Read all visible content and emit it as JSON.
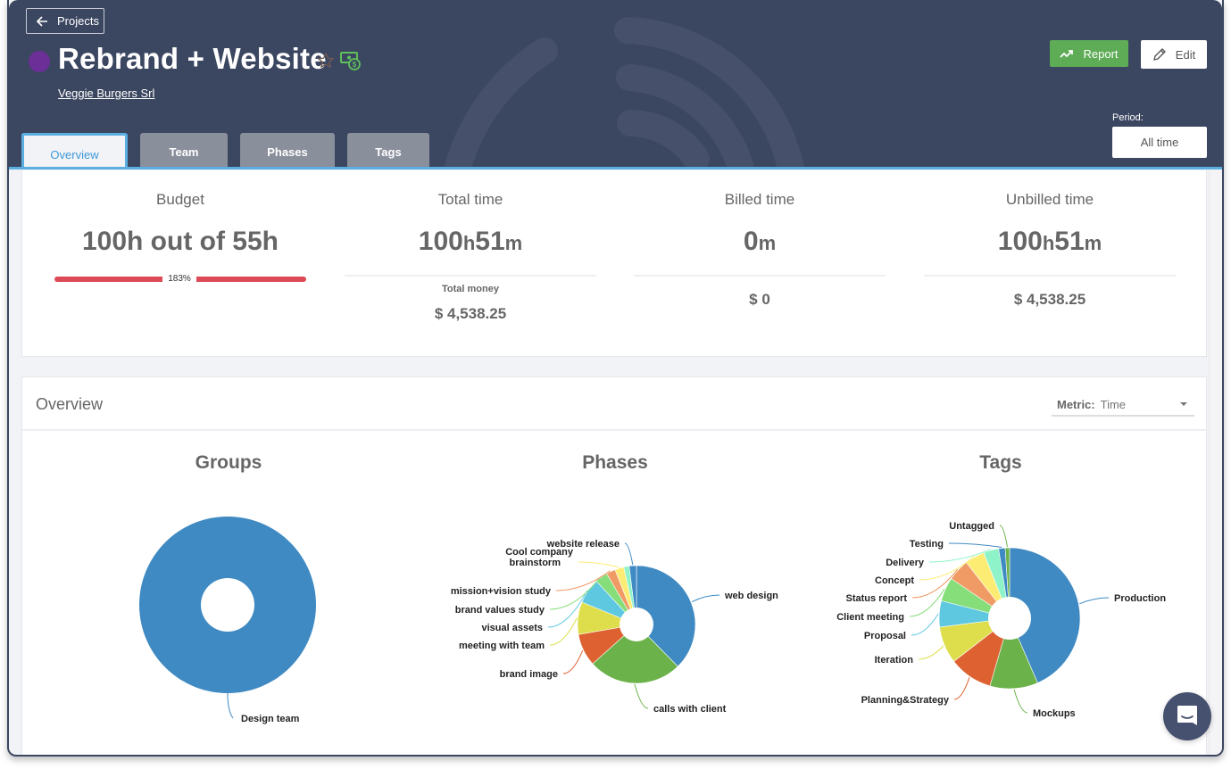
{
  "header": {
    "back_label": "Projects",
    "project_title": "Rebrand + Website",
    "project_color": "#6c2f98",
    "client_name": "Veggie Burgers Srl",
    "report_label": "Report",
    "edit_label": "Edit",
    "period_label": "Period:",
    "period_value": "All time"
  },
  "tabs": [
    {
      "label": "Overview",
      "active": true
    },
    {
      "label": "Team",
      "active": false
    },
    {
      "label": "Phases",
      "active": false
    },
    {
      "label": "Tags",
      "active": false
    }
  ],
  "stats": {
    "budget": {
      "label": "Budget",
      "value": "100h out of 55h",
      "percent_label": "183%",
      "percent": 183,
      "bar_color": "#dc4b55"
    },
    "total_time": {
      "label": "Total time",
      "hours": "100",
      "h": "h",
      "minutes": "51",
      "m": "m",
      "money_label": "Total money",
      "money": "$ 4,538.25"
    },
    "billed_time": {
      "label": "Billed time",
      "minutes": "0",
      "m": "m",
      "money": "$ 0"
    },
    "unbilled_time": {
      "label": "Unbilled time",
      "hours": "100",
      "h": "h",
      "minutes": "51",
      "m": "m",
      "money": "$ 4,538.25"
    }
  },
  "overview": {
    "title": "Overview",
    "metric_label": "Metric:",
    "metric_value": "Time"
  },
  "chart_data": [
    {
      "type": "pie",
      "title": "Groups",
      "slices": [
        {
          "label": "Design team",
          "value": 100,
          "color": "#3f8ac2"
        }
      ]
    },
    {
      "type": "pie",
      "title": "Phases",
      "slices": [
        {
          "label": "web design",
          "value": 38,
          "color": "#3f8ac2"
        },
        {
          "label": "calls with client",
          "value": 26,
          "color": "#6cb24a"
        },
        {
          "label": "brand image",
          "value": 9,
          "color": "#de6231"
        },
        {
          "label": "meeting with team",
          "value": 9,
          "color": "#dede4c"
        },
        {
          "label": "visual assets",
          "value": 7,
          "color": "#5ec8e0"
        },
        {
          "label": "brand values study",
          "value": 3.5,
          "color": "#86de7a"
        },
        {
          "label": "mission+vision study",
          "value": 2.5,
          "color": "#f09a65"
        },
        {
          "label": "Cool company brainstorm",
          "value": 2.5,
          "color": "#fdec74"
        },
        {
          "label": "",
          "value": 1.5,
          "color": "#8ef3c8"
        },
        {
          "label": "website release",
          "value": 2,
          "color": "#3f8ac2"
        }
      ]
    },
    {
      "type": "pie",
      "title": "Tags",
      "slices": [
        {
          "label": "Production",
          "value": 43.5,
          "color": "#3f8ac2"
        },
        {
          "label": "Mockups",
          "value": 11,
          "color": "#6cb24a"
        },
        {
          "label": "Planning&Strategy",
          "value": 10,
          "color": "#de6231"
        },
        {
          "label": "Iteration",
          "value": 8.5,
          "color": "#dede4c"
        },
        {
          "label": "Proposal",
          "value": 6,
          "color": "#5ec8e0"
        },
        {
          "label": "Client meeting",
          "value": 5.5,
          "color": "#86de7a"
        },
        {
          "label": "Status report",
          "value": 5,
          "color": "#f09a65"
        },
        {
          "label": "Concept",
          "value": 4.5,
          "color": "#fdec74"
        },
        {
          "label": "Delivery",
          "value": 3.5,
          "color": "#8ef3c8"
        },
        {
          "label": "Testing",
          "value": 1.5,
          "color": "#3f8ac2"
        },
        {
          "label": "Untagged",
          "value": 1,
          "color": "#6cb24a"
        }
      ]
    }
  ]
}
